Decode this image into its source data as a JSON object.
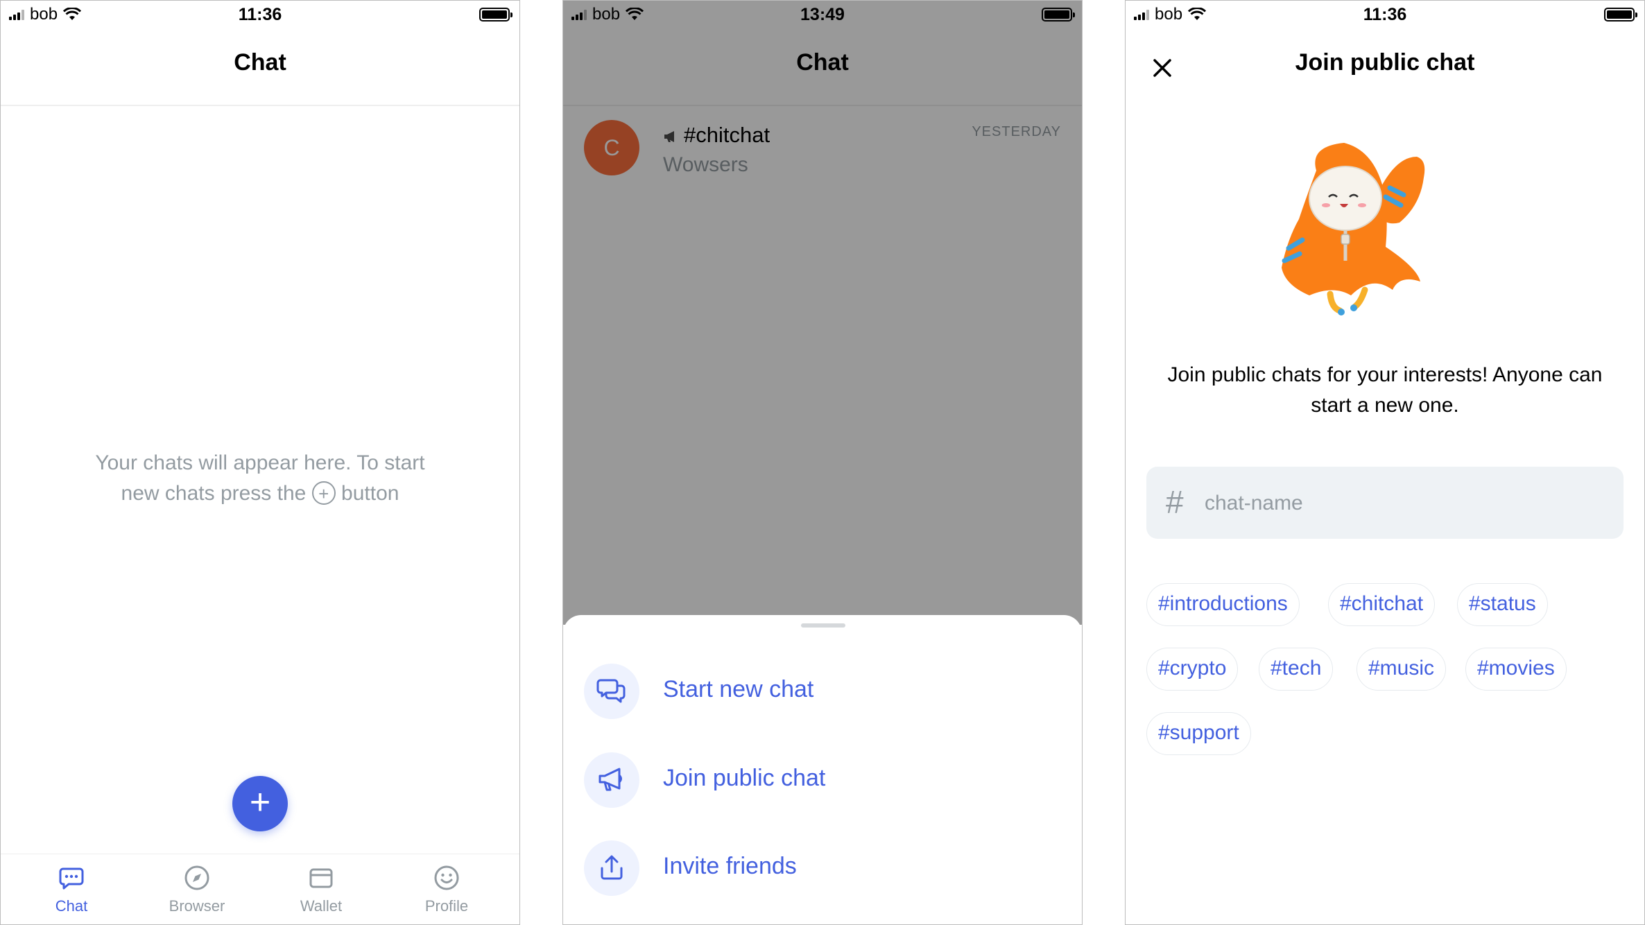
{
  "screen1": {
    "status": {
      "carrier": "bob",
      "time": "11:36"
    },
    "title": "Chat",
    "empty_line1": "Your chats will appear here. To start",
    "empty_line2_before": "new chats press the",
    "empty_plus": "+",
    "empty_line2_after": "button",
    "fab": "+",
    "tabs": [
      {
        "label": "Chat",
        "icon": "chat-icon",
        "active": true
      },
      {
        "label": "Browser",
        "icon": "compass-icon",
        "active": false
      },
      {
        "label": "Wallet",
        "icon": "wallet-icon",
        "active": false
      },
      {
        "label": "Profile",
        "icon": "smiley-icon",
        "active": false
      }
    ]
  },
  "screen2": {
    "status": {
      "carrier": "bob",
      "time": "13:49"
    },
    "title": "Chat",
    "chat": {
      "avatar_letter": "C",
      "name": "#chitchat",
      "last_message": "Wowsers",
      "time": "YESTERDAY"
    },
    "actions": [
      {
        "label": "Start new chat",
        "icon": "new-chat-icon"
      },
      {
        "label": "Join public chat",
        "icon": "megaphone-icon"
      },
      {
        "label": "Invite friends",
        "icon": "share-icon"
      }
    ]
  },
  "screen3": {
    "status": {
      "carrier": "bob",
      "time": "11:36"
    },
    "title": "Join public chat",
    "intro_line1": "Join public chats for your interests! Anyone can",
    "intro_line2": "start a new one.",
    "input": {
      "prefix": "#",
      "placeholder": "chat-name",
      "value": ""
    },
    "chips": [
      "#introductions",
      "#chitchat",
      "#status",
      "#crypto",
      "#tech",
      "#music",
      "#movies",
      "#support"
    ]
  },
  "colors": {
    "accent": "#4360df",
    "secondary_text": "#939ba1",
    "avatar": "#fa6e3c",
    "accent_bg": "#eef2fe",
    "input_bg": "#eef2f5"
  }
}
